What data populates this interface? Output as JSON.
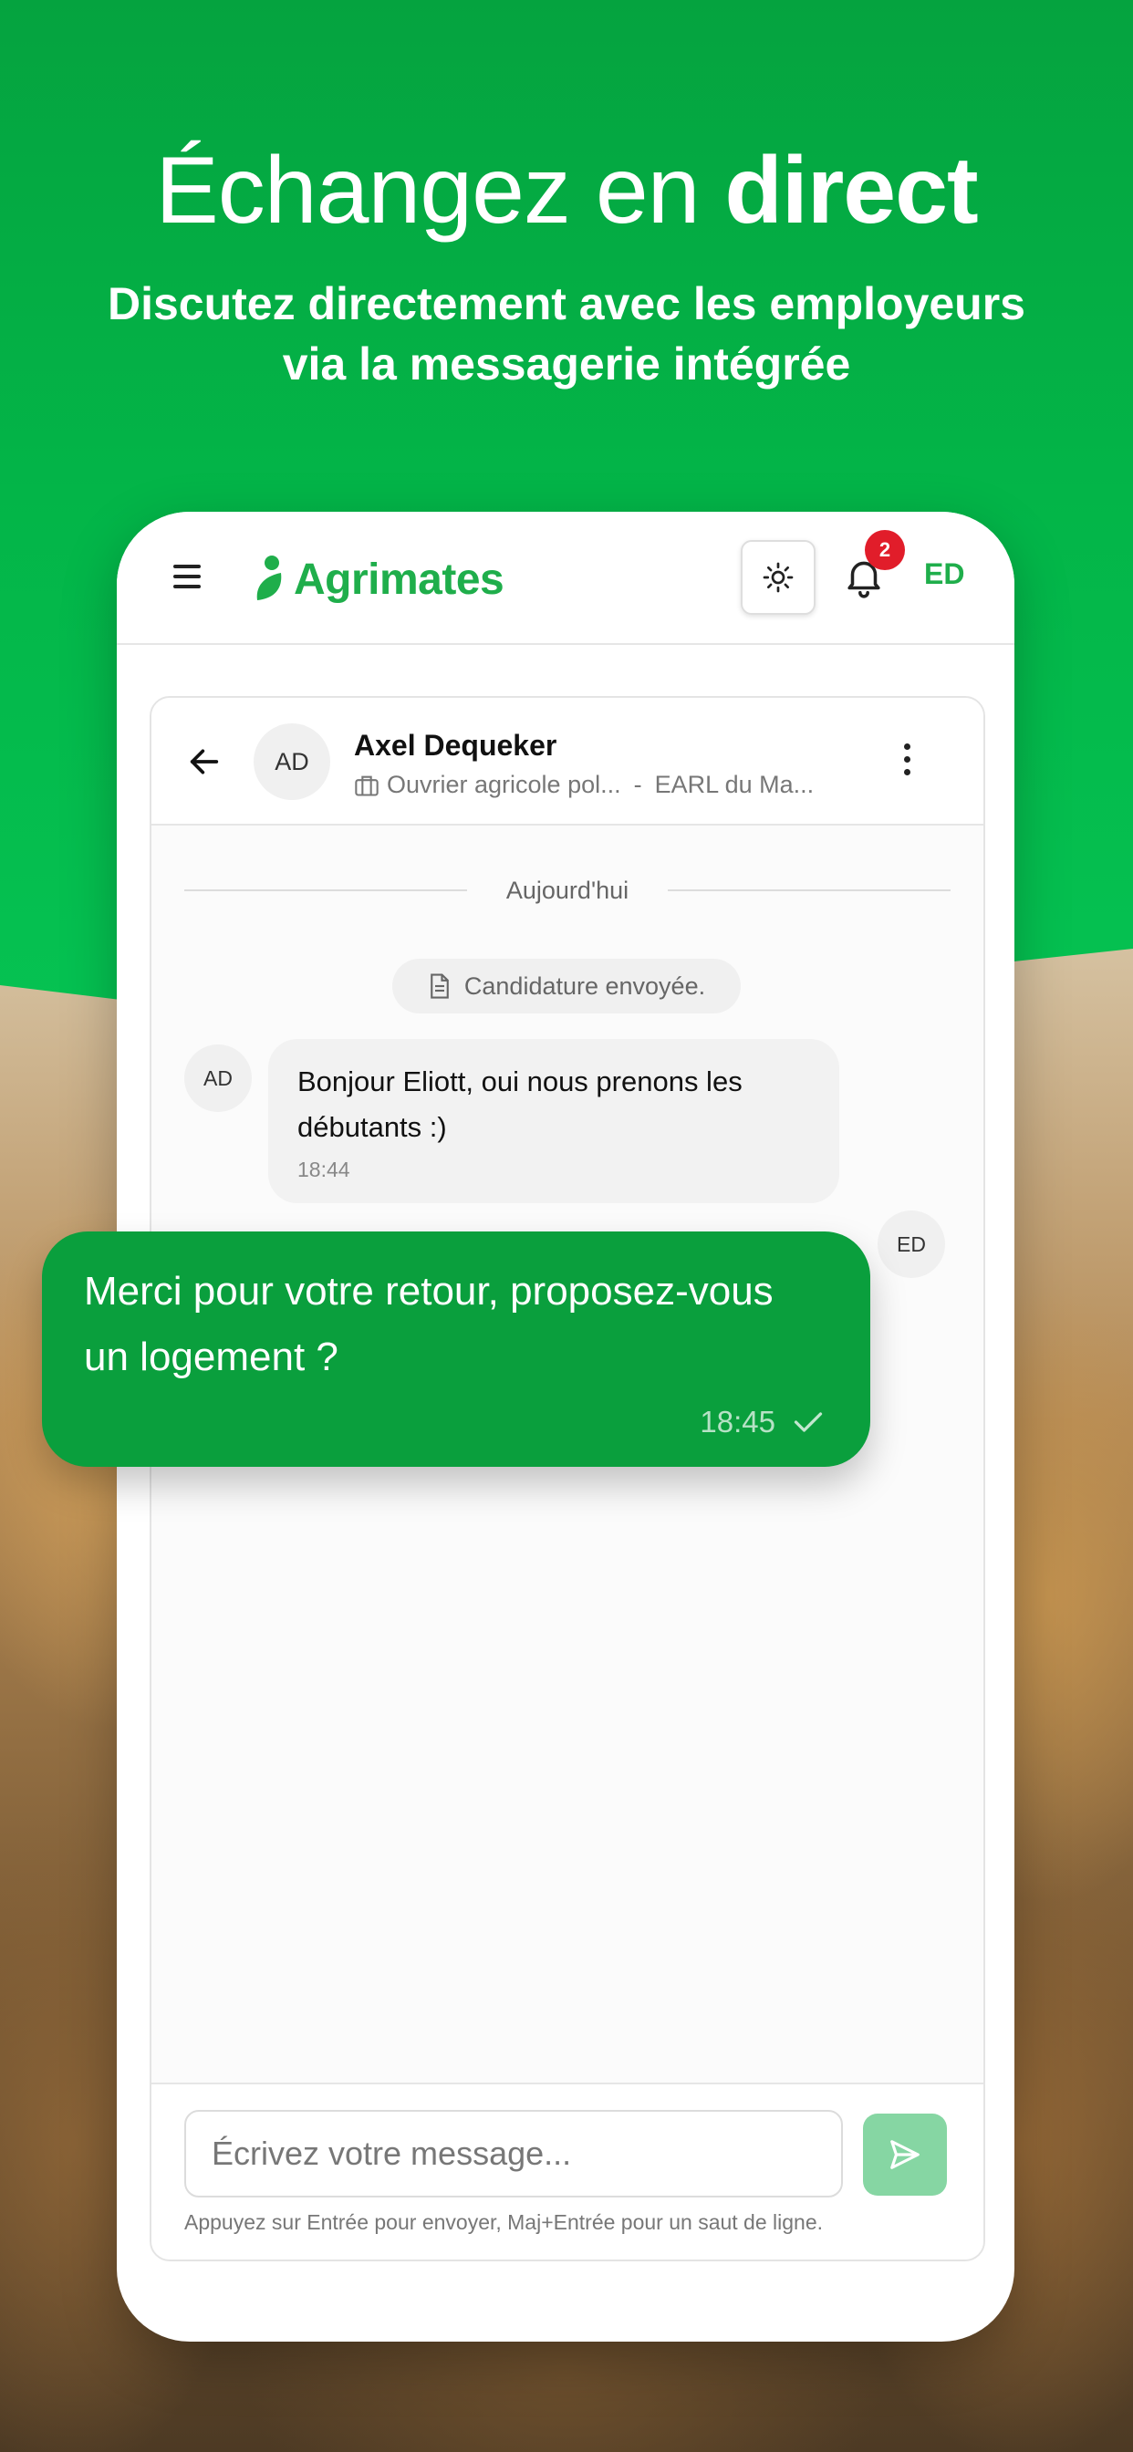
{
  "hero": {
    "title_light": "Échangez en ",
    "title_bold": "direct",
    "subtitle": "Discutez directement avec les employeurs via la messagerie intégrée"
  },
  "app": {
    "brand": "Agrimates",
    "brand_color": "#1fae4b",
    "notification_count": "2",
    "user_initials": "ED"
  },
  "conversation": {
    "contact_initials": "AD",
    "contact_name": "Axel Dequeker",
    "job_title": "Ouvrier agricole pol...",
    "separator": "-",
    "company": "EARL du Ma...",
    "day_label": "Aujourd'hui",
    "system_message": "Candidature envoyée.",
    "messages": [
      {
        "sender": "AD",
        "text": "Bonjour Eliott, oui nous prenons les débutants :)",
        "time": "18:44"
      },
      {
        "sender": "ED",
        "text": "Merci pour votre retour, proposez-vous un logement ?",
        "time": "18:45",
        "status": "check-icon"
      }
    ]
  },
  "composer": {
    "placeholder": "Écrivez votre message...",
    "hint": "Appuyez sur Entrée pour envoyer, Maj+Entrée pour un saut de ligne."
  },
  "colors": {
    "primary_green": "#0a9f3d",
    "badge_red": "#e11d2a",
    "send_disabled": "#86d6a3"
  }
}
